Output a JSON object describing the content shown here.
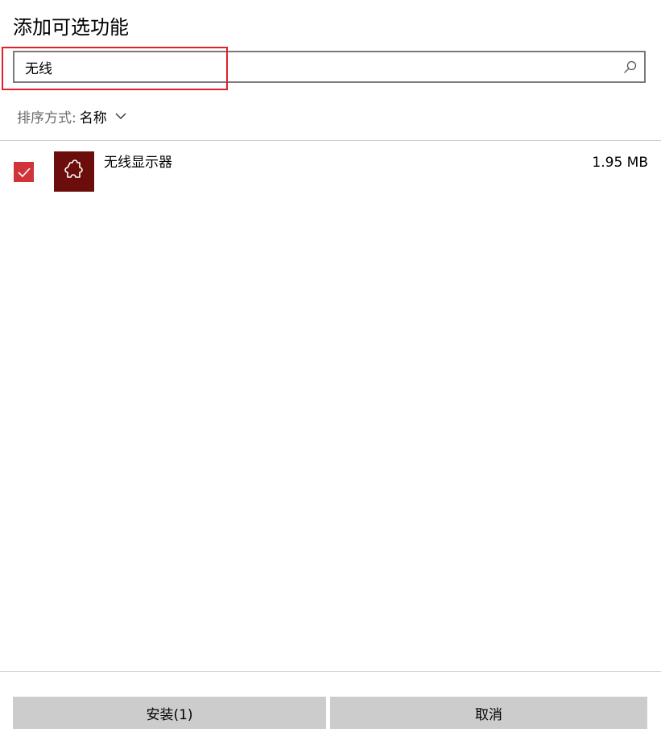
{
  "dialog": {
    "title": "添加可选功能"
  },
  "search": {
    "value": "无线",
    "icon": "search-icon"
  },
  "sort": {
    "label": "排序方式:",
    "value": "名称",
    "icon": "chevron-down-icon"
  },
  "features": [
    {
      "name": "无线显示器",
      "size": "1.95 MB",
      "checked": true,
      "icon": "puzzle-piece-icon"
    }
  ],
  "buttons": {
    "install_label": "安装(1)",
    "cancel_label": "取消"
  },
  "colors": {
    "checkbox_accent": "#d13438",
    "feature_icon_bg": "#6b0d0a",
    "highlight": "#e0202a",
    "button_bg": "#cccccc"
  }
}
